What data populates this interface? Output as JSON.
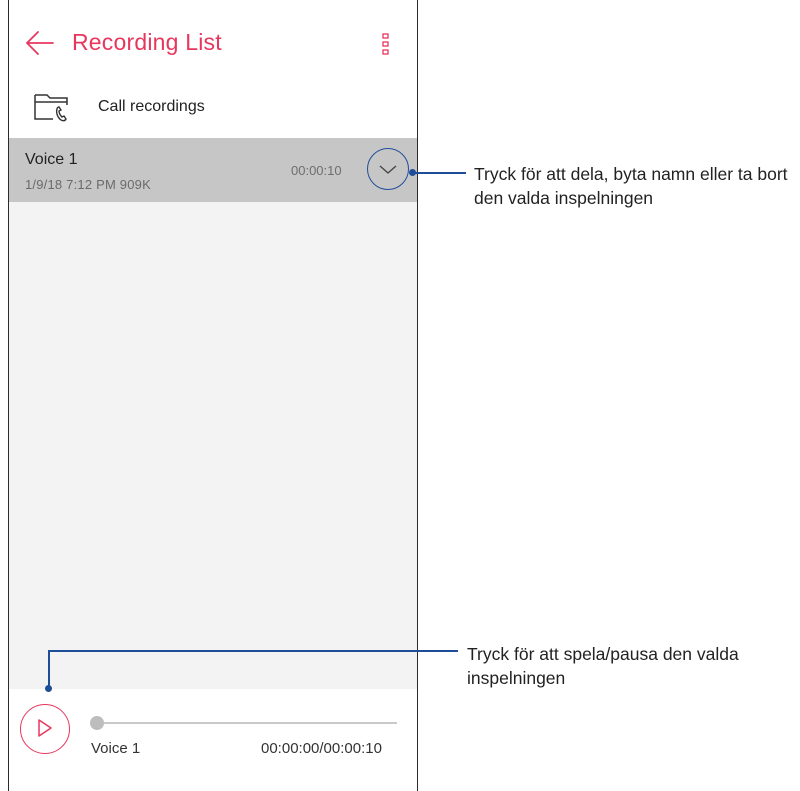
{
  "app": {
    "title": "Recording List"
  },
  "icons": {
    "back": "arrow-left-icon",
    "more": "more-vert-icon",
    "folder": "call-folder-icon",
    "expand": "chevron-down-icon",
    "play": "play-icon"
  },
  "colors": {
    "accent": "#e8375e",
    "callout_line": "#1f4e99",
    "selected_row": "#c6c6c6",
    "list_bg": "#f3f3f3"
  },
  "folder": {
    "label": "Call recordings"
  },
  "recordings": [
    {
      "name": "Voice 1",
      "meta": "1/9/18 7:12 PM   909K",
      "duration": "00:00:10",
      "selected": true
    }
  ],
  "player": {
    "name": "Voice 1",
    "time": "00:00:00/00:00:10",
    "progress": 0
  },
  "callouts": {
    "expand": "Tryck för att dela, byta namn eller ta bort den valda inspelningen",
    "play": "Tryck för att spela/pausa den valda inspelningen"
  }
}
